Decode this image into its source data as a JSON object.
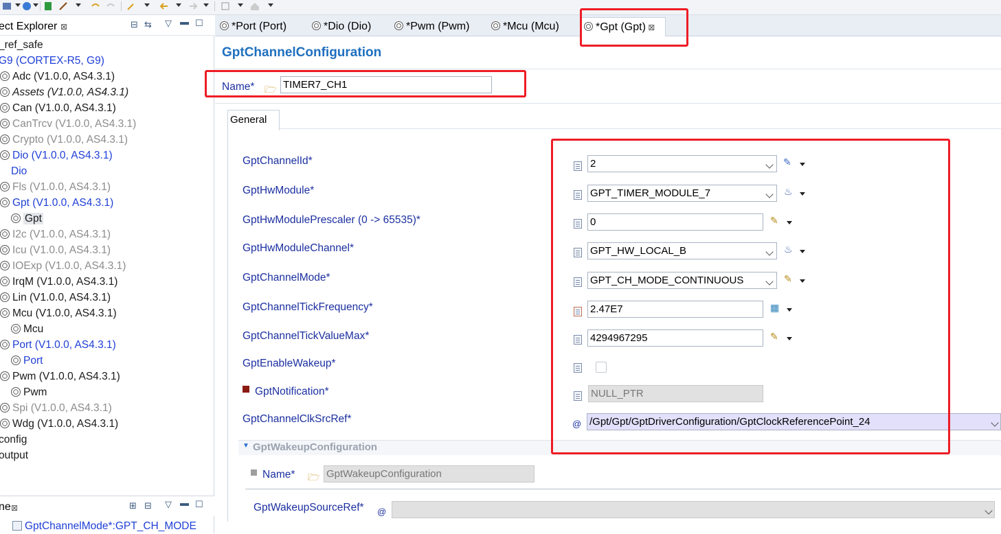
{
  "project_explorer": {
    "title": "ect Explorer",
    "tree": [
      {
        "label": "_ref_safe",
        "style": "black",
        "indent": 0,
        "icon": "none"
      },
      {
        "label": "G9 (CORTEX-R5, G9)",
        "style": "blue",
        "indent": 0,
        "icon": "none"
      },
      {
        "label": "Adc (V1.0.0, AS4.3.1)",
        "style": "black",
        "indent": 1,
        "icon": "gear-icon"
      },
      {
        "label": "Assets (V1.0.0, AS4.3.1)",
        "style": "black-italic",
        "indent": 1,
        "icon": "gear-icon"
      },
      {
        "label": "Can (V1.0.0, AS4.3.1)",
        "style": "black",
        "indent": 1,
        "icon": "gear-icon"
      },
      {
        "label": "CanTrcv (V1.0.0, AS4.3.1)",
        "style": "gray",
        "indent": 1,
        "icon": "gear-icon"
      },
      {
        "label": "Crypto (V1.0.0, AS4.3.1)",
        "style": "gray",
        "indent": 1,
        "icon": "gear-icon"
      },
      {
        "label": "Dio (V1.0.0, AS4.3.1)",
        "style": "blue",
        "indent": 1,
        "icon": "gear-icon"
      },
      {
        "label": "Dio",
        "style": "blue",
        "indent": 2,
        "icon": "none"
      },
      {
        "label": "Fls (V1.0.0, AS4.3.1)",
        "style": "gray",
        "indent": 1,
        "icon": "gear-icon"
      },
      {
        "label": "Gpt (V1.0.0, AS4.3.1)",
        "style": "blue",
        "indent": 1,
        "icon": "gear-icon"
      },
      {
        "label": "Gpt",
        "style": "black-selected",
        "indent": 2,
        "icon": "gear-icon"
      },
      {
        "label": "I2c (V1.0.0, AS4.3.1)",
        "style": "gray",
        "indent": 1,
        "icon": "gear-icon"
      },
      {
        "label": "Icu (V1.0.0, AS4.3.1)",
        "style": "gray",
        "indent": 1,
        "icon": "gear-icon"
      },
      {
        "label": "IOExp (V1.0.0, AS4.3.1)",
        "style": "gray",
        "indent": 1,
        "icon": "gear-icon"
      },
      {
        "label": "IrqM (V1.0.0, AS4.3.1)",
        "style": "black",
        "indent": 1,
        "icon": "gear-icon"
      },
      {
        "label": "Lin (V1.0.0, AS4.3.1)",
        "style": "black",
        "indent": 1,
        "icon": "gear-icon"
      },
      {
        "label": "Mcu (V1.0.0, AS4.3.1)",
        "style": "black",
        "indent": 1,
        "icon": "gear-icon"
      },
      {
        "label": "Mcu",
        "style": "black",
        "indent": 2,
        "icon": "gear-icon"
      },
      {
        "label": "Port (V1.0.0, AS4.3.1)",
        "style": "blue",
        "indent": 1,
        "icon": "gear-icon"
      },
      {
        "label": "Port",
        "style": "blue",
        "indent": 2,
        "icon": "gear-icon"
      },
      {
        "label": "Pwm (V1.0.0, AS4.3.1)",
        "style": "black",
        "indent": 1,
        "icon": "gear-icon"
      },
      {
        "label": "Pwm",
        "style": "black",
        "indent": 2,
        "icon": "gear-icon"
      },
      {
        "label": "Spi (V1.0.0, AS4.3.1)",
        "style": "gray",
        "indent": 1,
        "icon": "gear-icon"
      },
      {
        "label": "Wdg (V1.0.0, AS4.3.1)",
        "style": "black",
        "indent": 1,
        "icon": "gear-icon"
      },
      {
        "label": "config",
        "style": "black",
        "indent": 0,
        "icon": "none"
      },
      {
        "label": "output",
        "style": "black",
        "indent": 0,
        "icon": "none"
      }
    ]
  },
  "outline": {
    "title": "ne",
    "item": "GptChannelMode*:GPT_CH_MODE"
  },
  "editor_tabs": [
    {
      "label": "*Port (Port)",
      "active": false
    },
    {
      "label": "*Dio (Dio)",
      "active": false
    },
    {
      "label": "*Pwm (Pwm)",
      "active": false
    },
    {
      "label": "*Mcu (Mcu)",
      "active": false
    },
    {
      "label": "*Gpt (Gpt)",
      "active": true
    }
  ],
  "editor": {
    "section_title": "GptChannelConfiguration",
    "name_label": "Name*",
    "name_value": "TIMER7_CH1",
    "general_tab": "General",
    "fields": {
      "channel_id": {
        "label": "GptChannelId*",
        "value": "2"
      },
      "hw_module": {
        "label": "GptHwModule*",
        "value": "GPT_TIMER_MODULE_7"
      },
      "hw_prescaler": {
        "label": "GptHwModulePrescaler (0 -> 65535)*",
        "value": "0"
      },
      "hw_channel": {
        "label": "GptHwModuleChannel*",
        "value": "GPT_HW_LOCAL_B"
      },
      "channel_mode": {
        "label": "GptChannelMode*",
        "value": "GPT_CH_MODE_CONTINUOUS"
      },
      "tick_frequency": {
        "label": "GptChannelTickFrequency*",
        "value": "2.47E7"
      },
      "tick_value_max": {
        "label": "GptChannelTickValueMax*",
        "value": "4294967295"
      },
      "enable_wakeup": {
        "label": "GptEnableWakeup*",
        "checked": false
      },
      "notification": {
        "label": "GptNotification*",
        "value": "NULL_PTR"
      },
      "clk_src_ref": {
        "label": "GptChannelClkSrcRef*",
        "value": "/Gpt/Gpt/GptDriverConfiguration/GptClockReferencePoint_24"
      }
    },
    "wakeup": {
      "section_title": "GptWakeupConfiguration",
      "name_label": "Name*",
      "name_value": "GptWakeupConfiguration",
      "source_ref_label": "GptWakeupSourceRef*",
      "source_ref_value": ""
    }
  },
  "colors": {
    "highlight_box": "#ee1c25",
    "label_blue": "#1b2fa0",
    "title_blue": "#1f6fbf"
  }
}
